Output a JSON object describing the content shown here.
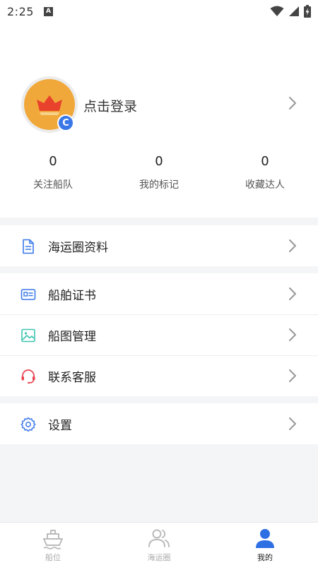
{
  "status_bar": {
    "time": "2:25",
    "notification": "A"
  },
  "profile": {
    "avatar_badge": "C",
    "login_text": "点击登录",
    "stats": [
      {
        "value": "0",
        "label": "关注船队"
      },
      {
        "value": "0",
        "label": "我的标记"
      },
      {
        "value": "0",
        "label": "收藏达人"
      }
    ]
  },
  "menu": {
    "shipping_circle_info": "海运圈资料",
    "ship_certificate": "船舶证书",
    "ship_drawing_management": "船图管理",
    "contact_support": "联系客服",
    "settings": "设置"
  },
  "tabbar": {
    "tabs": [
      {
        "label": "船位",
        "active": false
      },
      {
        "label": "海运圈",
        "active": false
      },
      {
        "label": "我的",
        "active": true
      }
    ]
  },
  "colors": {
    "accent_blue": "#3a78e8",
    "avatar_orange": "#f0a83a",
    "support_red": "#e8414d",
    "image_teal": "#3cc5b0",
    "background": "#f4f5f7"
  }
}
